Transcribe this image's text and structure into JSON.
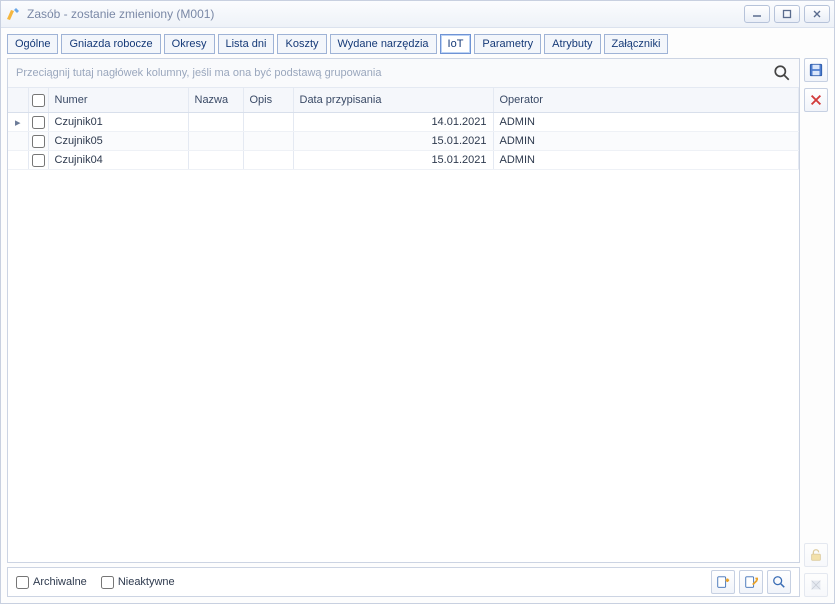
{
  "window": {
    "title": "Zasób - zostanie zmieniony  (M001)"
  },
  "tabs": [
    "Ogólne",
    "Gniazda robocze",
    "Okresy",
    "Lista dni",
    "Koszty",
    "Wydane narzędzia",
    "IoT",
    "Parametry",
    "Atrybuty",
    "Załączniki"
  ],
  "active_tab": 6,
  "group_hint": "Przeciągnij tutaj nagłówek kolumny, jeśli ma ona być podstawą grupowania",
  "columns": {
    "numer": "Numer",
    "nazwa": "Nazwa",
    "opis": "Opis",
    "data": "Data przypisania",
    "operator": "Operator"
  },
  "rows": [
    {
      "current": true,
      "checked": false,
      "numer": "Czujnik01",
      "nazwa": "",
      "opis": "",
      "data": "14.01.2021",
      "operator": "ADMIN"
    },
    {
      "current": false,
      "checked": false,
      "numer": "Czujnik05",
      "nazwa": "",
      "opis": "",
      "data": "15.01.2021",
      "operator": "ADMIN"
    },
    {
      "current": false,
      "checked": false,
      "numer": "Czujnik04",
      "nazwa": "",
      "opis": "",
      "data": "15.01.2021",
      "operator": "ADMIN"
    }
  ],
  "filters": {
    "archiwalne_label": "Archiwalne",
    "archiwalne": false,
    "nieaktywne_label": "Nieaktywne",
    "nieaktywne": false
  },
  "side": {
    "save": "save-icon",
    "delete": "delete-icon",
    "unlock": "unlock-icon",
    "patch": "patch-icon"
  },
  "bottom_actions": {
    "add": "add-icon",
    "link": "link-icon",
    "preview": "preview-icon"
  }
}
